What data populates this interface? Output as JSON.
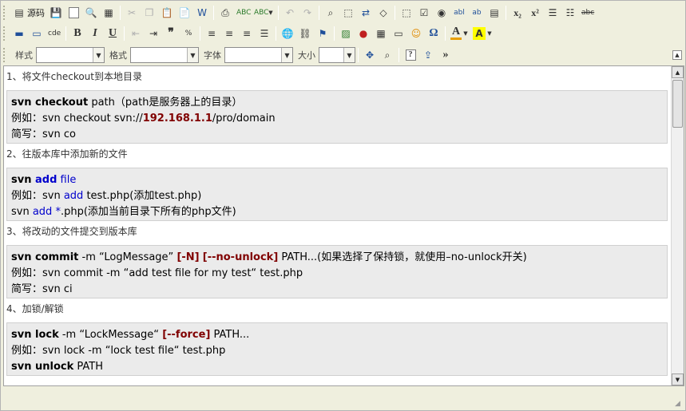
{
  "toolbar1": {
    "source_label": "源码"
  },
  "toolbar3": {
    "style_label": "样式",
    "format_label": "格式",
    "font_label": "字体",
    "size_label": "大小",
    "style_value": "",
    "format_value": "",
    "font_value": "",
    "size_value": ""
  },
  "content": {
    "sections": [
      {
        "heading": "1、将文件checkout到本地目录",
        "lines": [
          [
            {
              "t": "svn checkout",
              "c": "kw"
            },
            {
              "t": " path（path是服务器上的目录）",
              "c": ""
            }
          ],
          [
            {
              "t": "例如：svn checkout svn://",
              "c": ""
            },
            {
              "t": "192.168.1.1",
              "c": "ip"
            },
            {
              "t": "/pro/domain",
              "c": ""
            }
          ],
          [
            {
              "t": "简写：svn co",
              "c": ""
            }
          ]
        ]
      },
      {
        "heading": "2、往版本库中添加新的文件",
        "lines": [
          [
            {
              "t": "svn ",
              "c": "kw"
            },
            {
              "t": "add",
              "c": "kw blue"
            },
            {
              "t": " file",
              "c": "blue"
            }
          ],
          [
            {
              "t": "例如：svn ",
              "c": ""
            },
            {
              "t": "add",
              "c": "blue"
            },
            {
              "t": " test.php(添加test.php)",
              "c": ""
            }
          ],
          [
            {
              "t": "svn ",
              "c": ""
            },
            {
              "t": "add",
              "c": "blue"
            },
            {
              "t": " *",
              "c": "blue"
            },
            {
              "t": ".php(添加当前目录下所有的php文件)",
              "c": ""
            }
          ]
        ]
      },
      {
        "heading": "3、将改动的文件提交到版本库",
        "lines": [
          [
            {
              "t": "svn commit",
              "c": "kw"
            },
            {
              "t": " -m “LogMessage” ",
              "c": ""
            },
            {
              "t": "[-N]",
              "c": "dred"
            },
            {
              "t": " ",
              "c": ""
            },
            {
              "t": "[--no-unlock]",
              "c": "dred"
            },
            {
              "t": " PATH...(如果选择了保持锁，就使用–no-unlock开关)",
              "c": ""
            }
          ],
          [
            {
              "t": "例如：svn commit -m “add test file for my test“ test.php",
              "c": ""
            }
          ],
          [
            {
              "t": "简写：svn ci",
              "c": ""
            }
          ]
        ]
      },
      {
        "heading": "4、加锁/解锁",
        "lines": [
          [
            {
              "t": "svn lock",
              "c": "kw"
            },
            {
              "t": " -m “LockMessage“ ",
              "c": ""
            },
            {
              "t": "[--force]",
              "c": "dred"
            },
            {
              "t": " PATH...",
              "c": ""
            }
          ],
          [
            {
              "t": "例如：svn lock -m “lock test file“ test.php",
              "c": ""
            }
          ],
          [
            {
              "t": "svn unlock",
              "c": "kw"
            },
            {
              "t": " PATH",
              "c": ""
            }
          ]
        ]
      }
    ]
  },
  "colors": {
    "toolbar_bg": "#efefde",
    "code_block_bg": "#ebebeb",
    "keyword_blue": "#0000cc",
    "option_red": "#800000"
  }
}
